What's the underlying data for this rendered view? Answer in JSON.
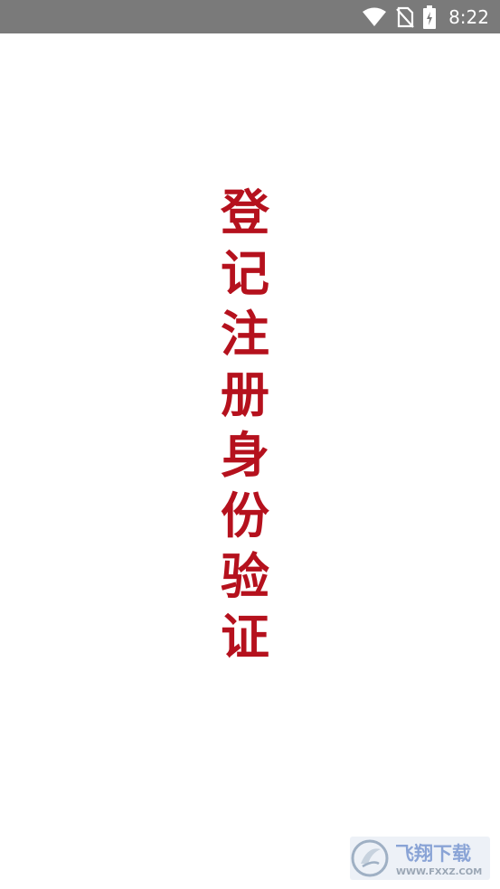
{
  "status_bar": {
    "time": "8:22",
    "icons": [
      "wifi-icon",
      "no-sim-icon",
      "battery-charging-icon"
    ]
  },
  "splash": {
    "characters": [
      "登",
      "记",
      "注",
      "册",
      "身",
      "份",
      "验",
      "证"
    ]
  },
  "watermark": {
    "brand": "飞翔下载",
    "url": "WWW.FXXZ.COM"
  },
  "colors": {
    "status_bar_bg": "#7a7a7a",
    "splash_text": "#b5111d",
    "background": "#ffffff"
  }
}
